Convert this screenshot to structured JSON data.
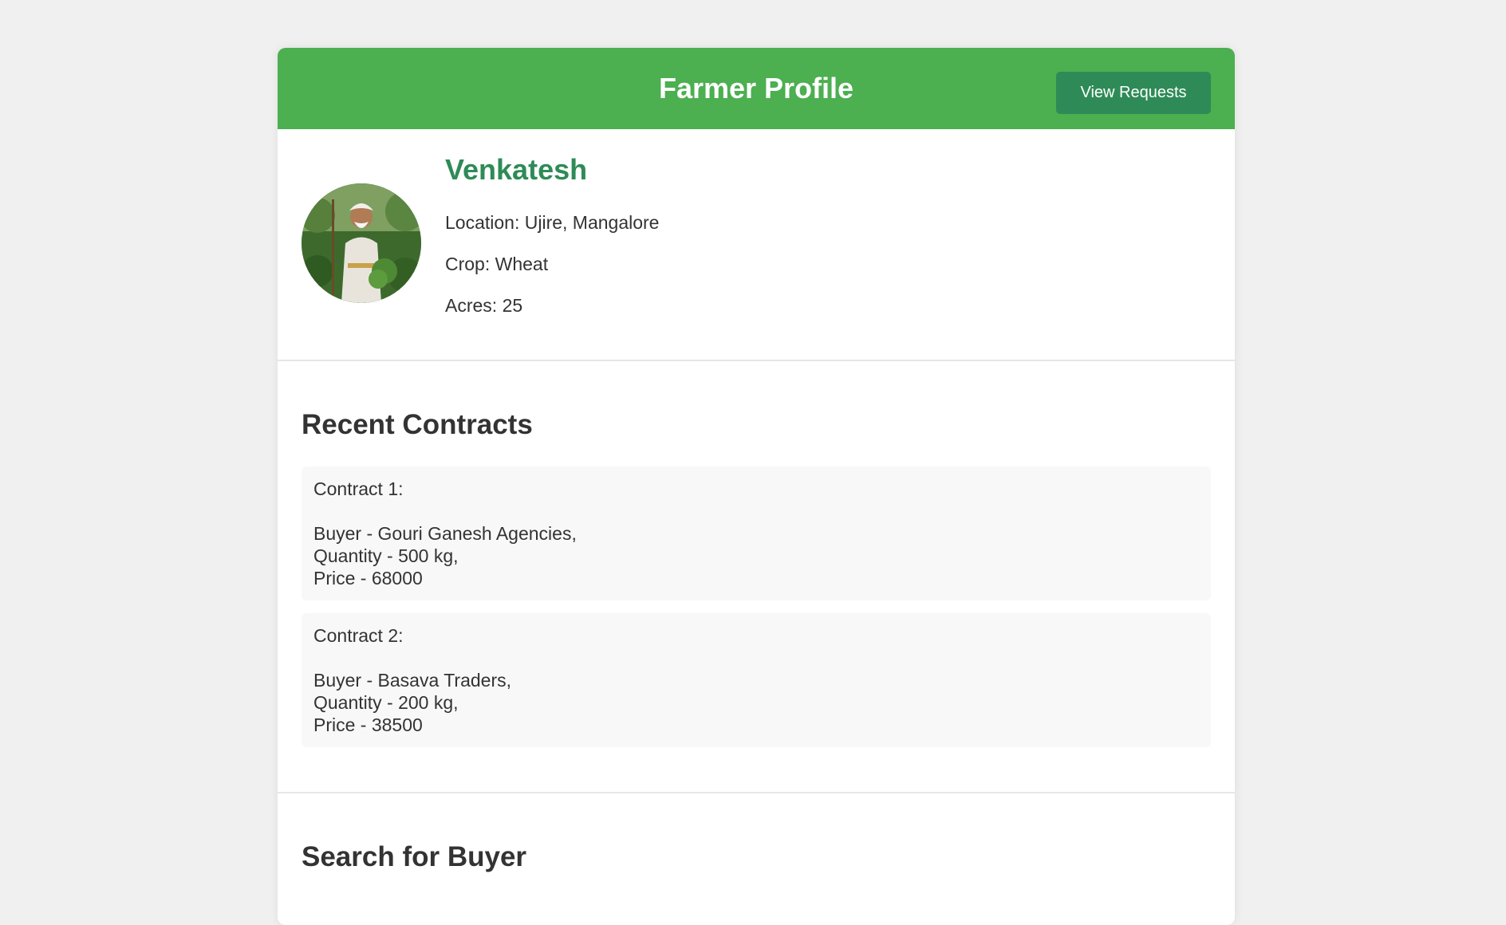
{
  "header": {
    "title": "Farmer Profile",
    "view_requests_label": "View Requests"
  },
  "profile": {
    "avatar_icon": "farmer-photo",
    "name": "Venkatesh",
    "location": "Location: Ujire, Mangalore",
    "crop": "Crop: Wheat",
    "acres": "Acres: 25"
  },
  "recent_contracts": {
    "title": "Recent Contracts",
    "items": [
      {
        "heading": "Contract 1:",
        "buyer": "Buyer - Gouri Ganesh Agencies,",
        "quantity": "Quantity - 500 kg,",
        "price": "Price - 68000"
      },
      {
        "heading": "Contract 2:",
        "buyer": "Buyer - Basava Traders,",
        "quantity": "Quantity - 200 kg,",
        "price": "Price - 38500"
      }
    ]
  },
  "search": {
    "title": "Search for Buyer"
  },
  "colors": {
    "header_bg": "#4caf50",
    "button_bg": "#2e8b57",
    "name_color": "#2e8b57",
    "page_bg": "#f0f0f0"
  }
}
